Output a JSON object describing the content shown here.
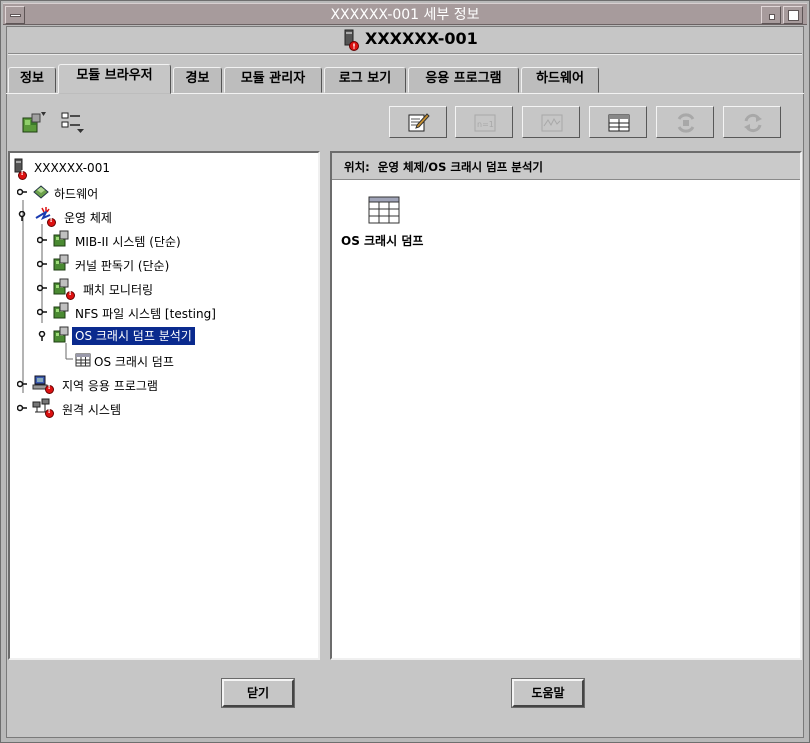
{
  "window": {
    "title": "XXXXXX-001 세부 정보"
  },
  "header": {
    "host_name": "XXXXXX-001"
  },
  "tabs": [
    {
      "label": "정보"
    },
    {
      "label": "모듈 브라우저",
      "selected": true
    },
    {
      "label": "경보"
    },
    {
      "label": "모듈 관리자"
    },
    {
      "label": "로그 보기"
    },
    {
      "label": "응용 프로그램"
    },
    {
      "label": "하드웨어"
    }
  ],
  "location": {
    "label": "위치:",
    "path": "운영 체제/OS 크래시 덤프 분석기"
  },
  "tree": {
    "root": "XXXXXX-001",
    "hardware": "하드웨어",
    "os": "운영 체제",
    "mib2": "MIB-II 시스템 (단순)",
    "kernel_reader": "커널 판독기 (단순)",
    "patch_monitoring": "패치 모니터링",
    "nfs": "NFS 파일 시스템 [testing]",
    "crash_dump_analyzer": "OS 크래시 덤프 분석기",
    "crash_dump_table": "OS 크래시 덤프",
    "local_apps": "지역 응용 프로그램",
    "remote_systems": "원격 시스템"
  },
  "detail": {
    "tile_label": "OS 크래시 덤프"
  },
  "buttons": {
    "close": "닫기",
    "help": "도움말"
  },
  "colors": {
    "titlebar": "#a79b9c",
    "selection": "#0a2a8e",
    "alarm": "#dd1111"
  }
}
